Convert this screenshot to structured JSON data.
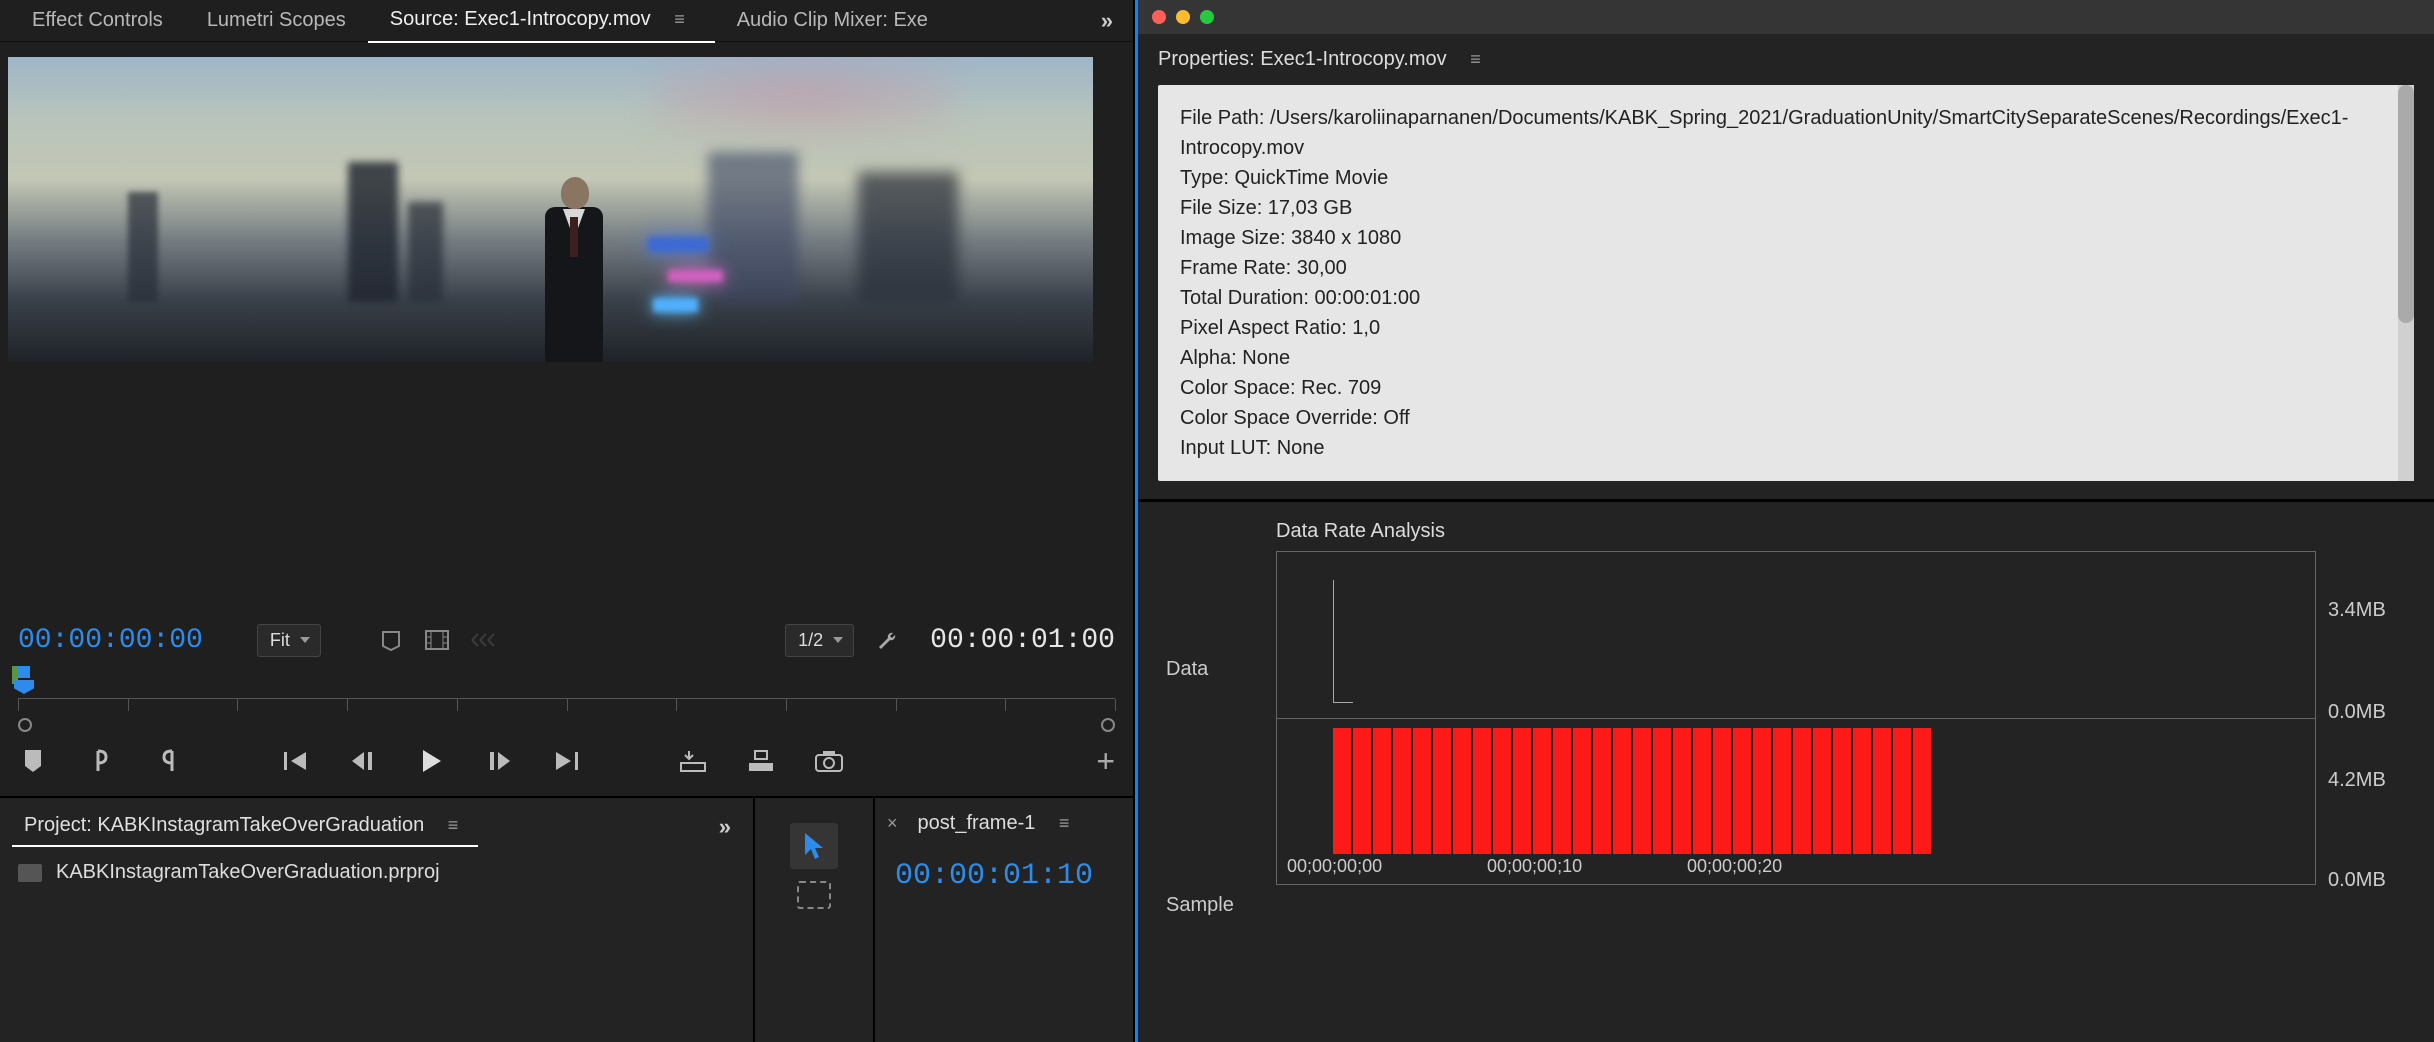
{
  "tabs": {
    "effect_controls": "Effect Controls",
    "lumetri_scopes": "Lumetri Scopes",
    "source": "Source: Exec1-Introcopy.mov",
    "audio_mixer": "Audio Clip Mixer: Exe"
  },
  "source_monitor": {
    "current_tc": "00:00:00:00",
    "duration_tc": "00:00:01:00",
    "zoom_fit": "Fit",
    "resolution": "1/2"
  },
  "project_panel": {
    "tab_label": "Project: KABKInstagramTakeOverGraduation",
    "file_name": "KABKInstagramTakeOverGraduation.prproj"
  },
  "sequence_panel": {
    "tab_label": "post_frame-1",
    "timecode": "00:00:01:10"
  },
  "properties_window": {
    "title": "Properties: Exec1-Introcopy.mov",
    "lines": {
      "file_path": "File Path: /Users/karoliinaparnanen/Documents/KABK_Spring_2021/GraduationUnity/SmartCitySeparateScenes/Recordings/Exec1-Introcopy.mov",
      "type": "Type: QuickTime Movie",
      "file_size": "File Size: 17,03 GB",
      "image_size": "Image Size: 3840 x 1080",
      "frame_rate": "Frame Rate: 30,00",
      "total_duration": "Total Duration: 00:00:01:00",
      "pixel_aspect": "Pixel Aspect Ratio: 1,0",
      "alpha": "Alpha: None",
      "color_space": "Color Space: Rec. 709",
      "color_override": "Color Space Override: Off",
      "input_lut": "Input LUT: None"
    }
  },
  "data_rate_chart": {
    "title": "Data Rate Analysis",
    "y_label_top": "Data",
    "y_label_bottom": "Sample",
    "right_labels": {
      "data_max": "3.4MB",
      "data_min": "0.0MB",
      "sample_max": "4.2MB",
      "sample_min": "0.0MB"
    },
    "x_ticks": {
      "t0": "00;00;00;00",
      "t10": "00;00;00;10",
      "t20": "00;00;00;20"
    }
  },
  "chart_data": {
    "type": "bar",
    "title": "Data Rate Analysis",
    "x_unit": "timecode (frames, 30fps)",
    "series": [
      {
        "name": "Data",
        "y_unit": "MB/frame",
        "ylim": [
          0,
          3.4
        ],
        "x": [
          "00;00;00;00"
        ],
        "values": [
          3.4
        ],
        "note": "single spike near start, then 0"
      },
      {
        "name": "Sample",
        "y_unit": "MB/frame",
        "ylim": [
          0,
          4.2
        ],
        "x": [
          "00;00;00;00",
          "00;00;00;01",
          "00;00;00;02",
          "00;00;00;03",
          "00;00;00;04",
          "00;00;00;05",
          "00;00;00;06",
          "00;00;00;07",
          "00;00;00;08",
          "00;00;00;09",
          "00;00;00;10",
          "00;00;00;11",
          "00;00;00;12",
          "00;00;00;13",
          "00;00;00;14",
          "00;00;00;15",
          "00;00;00;16",
          "00;00;00;17",
          "00;00;00;18",
          "00;00;00;19",
          "00;00;00;20",
          "00;00;00;21",
          "00;00;00;22",
          "00;00;00;23",
          "00;00;00;24",
          "00;00;00;25",
          "00;00;00;26",
          "00;00;00;27",
          "00;00;00;28",
          "00;00;00;29"
        ],
        "values": [
          3.9,
          3.9,
          3.9,
          3.9,
          3.9,
          3.9,
          3.9,
          3.9,
          3.9,
          3.9,
          3.9,
          3.9,
          3.9,
          3.9,
          3.9,
          3.9,
          3.9,
          3.9,
          3.9,
          3.9,
          3.9,
          3.9,
          3.9,
          3.9,
          3.9,
          3.9,
          3.9,
          3.9,
          3.9,
          3.9
        ]
      }
    ]
  }
}
